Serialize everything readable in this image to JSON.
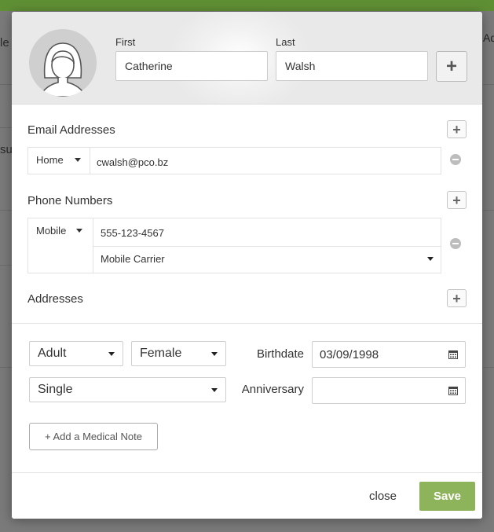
{
  "background": {
    "left_fragments": [
      "le",
      "su"
    ],
    "right_fragment": "Ad"
  },
  "profile": {
    "first_label": "First",
    "first_value": "Catherine",
    "last_label": "Last",
    "last_value": "Walsh",
    "add_name_label": "+"
  },
  "email": {
    "title": "Email Addresses",
    "add_label": "+",
    "items": [
      {
        "type": "Home",
        "value": "cwalsh@pco.bz"
      }
    ]
  },
  "phone": {
    "title": "Phone Numbers",
    "add_label": "+",
    "items": [
      {
        "type": "Mobile",
        "value": "555-123-4567",
        "carrier": "Mobile Carrier"
      }
    ]
  },
  "addresses": {
    "title": "Addresses",
    "add_label": "+"
  },
  "details": {
    "age_group": "Adult",
    "gender": "Female",
    "marital_status": "Single",
    "birthdate_label": "Birthdate",
    "birthdate_value": "03/09/1998",
    "anniversary_label": "Anniversary",
    "anniversary_value": ""
  },
  "medical_button_label": "+ Add a Medical Note",
  "footer": {
    "close_label": "close",
    "save_label": "Save"
  },
  "colors": {
    "accent_green": "#8db35b",
    "topbar_green": "#5f8f35"
  }
}
